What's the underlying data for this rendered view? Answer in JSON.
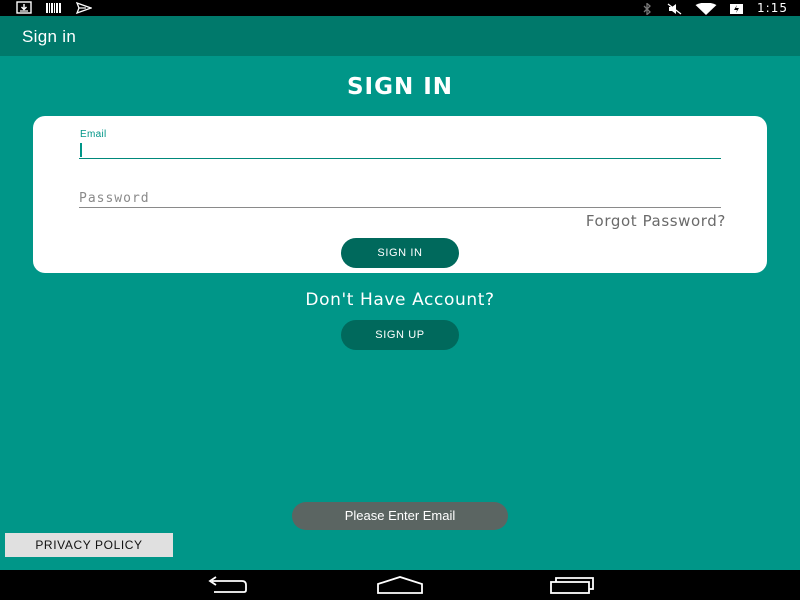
{
  "status_bar": {
    "time": "1:15",
    "icons": [
      "download-icon",
      "barcode-icon",
      "send-icon",
      "bluetooth-icon",
      "volume-off-icon",
      "wifi-icon",
      "battery-icon"
    ]
  },
  "app_bar": {
    "title": "Sign in"
  },
  "heading": "SIGN IN",
  "form": {
    "email_label": "Email",
    "email_value": "",
    "password_placeholder": "Password",
    "password_value": "",
    "forgot_password": "Forgot Password?",
    "sign_in_button": "SIGN IN"
  },
  "signup": {
    "prompt": "Don't Have Account?",
    "button": "SIGN UP"
  },
  "toast": "Please Enter Email",
  "privacy_button": "PRIVACY POLICY",
  "nav_bar": {
    "icons": [
      "back-icon",
      "home-icon",
      "recents-icon"
    ]
  },
  "colors": {
    "background": "#009688",
    "app_bar": "#00796b",
    "button": "#00695c",
    "accent": "#009688"
  }
}
